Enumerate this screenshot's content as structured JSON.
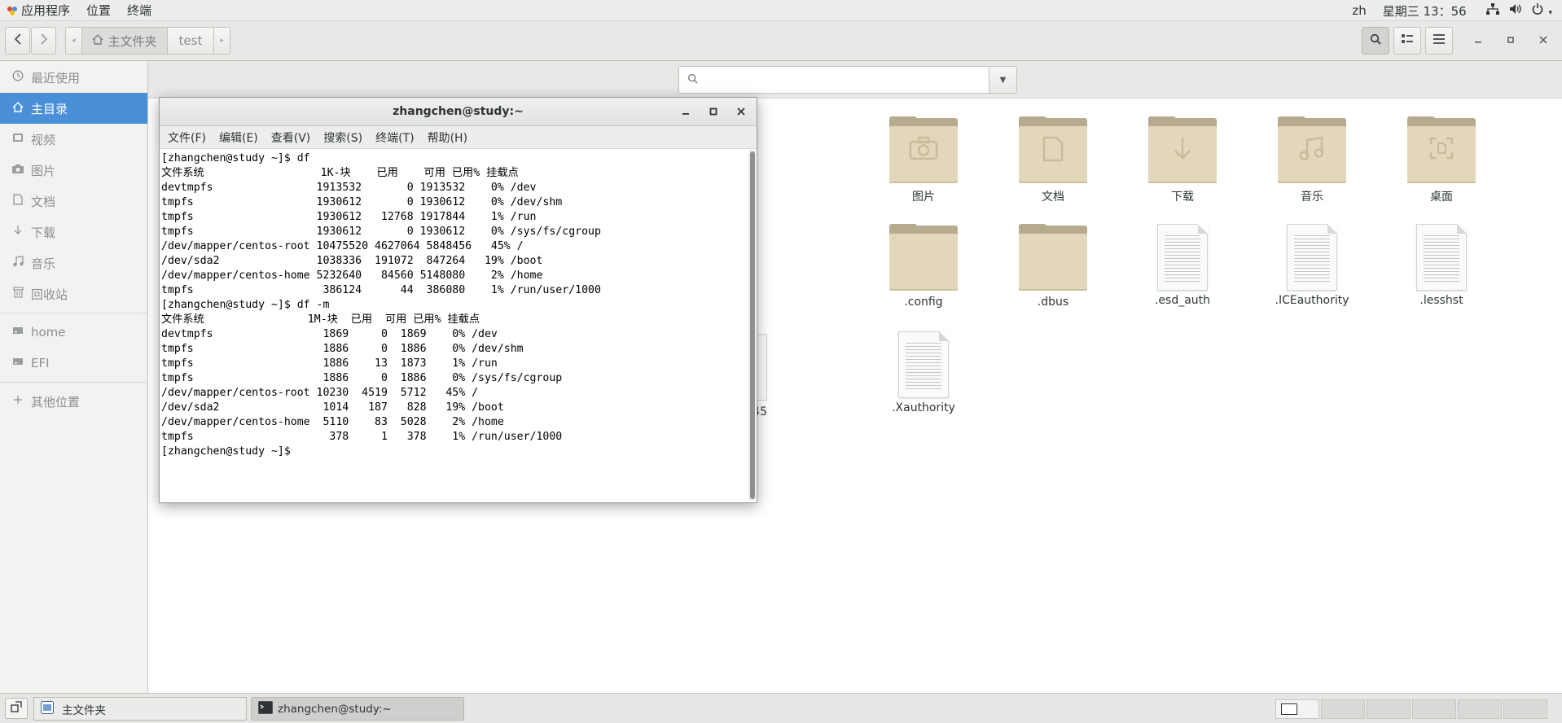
{
  "topbar": {
    "apps_label": "应用程序",
    "places_label": "位置",
    "terminal_label": "终端",
    "lang": "zh",
    "clock": "星期三 13：56"
  },
  "header": {
    "path_home": "主文件夹",
    "path_test": "test"
  },
  "sidebar": {
    "items": [
      {
        "label": "最近使用",
        "icon": "clock-icon"
      },
      {
        "label": "主目录",
        "icon": "home-icon"
      },
      {
        "label": "视频",
        "icon": "video-icon"
      },
      {
        "label": "图片",
        "icon": "camera-icon"
      },
      {
        "label": "文档",
        "icon": "document-icon"
      },
      {
        "label": "下载",
        "icon": "download-icon"
      },
      {
        "label": "音乐",
        "icon": "music-icon"
      },
      {
        "label": "回收站",
        "icon": "trash-icon"
      },
      {
        "label": "home",
        "icon": "drive-icon"
      },
      {
        "label": "EFI",
        "icon": "drive-icon"
      },
      {
        "label": "其他位置",
        "icon": "plus-icon"
      }
    ]
  },
  "files": [
    {
      "label": "图片",
      "type": "folder",
      "icon": "camera-icon"
    },
    {
      "label": "文档",
      "type": "folder",
      "icon": "document-icon"
    },
    {
      "label": "下载",
      "type": "folder",
      "icon": "download-icon"
    },
    {
      "label": "音乐",
      "type": "folder",
      "icon": "music-icon"
    },
    {
      "label": "桌面",
      "type": "folder",
      "icon": "desktop-icon"
    },
    {
      "label": ".config",
      "type": "folder"
    },
    {
      "label": ".dbus",
      "type": "folder"
    },
    {
      "label": ".esd_auth",
      "type": "file"
    },
    {
      "label": ".ICEauthority",
      "type": "file"
    },
    {
      "label": ".lesshst",
      "type": "file"
    },
    {
      "label": "3345",
      "type": "file"
    },
    {
      "label": ".Xauthority",
      "type": "file"
    }
  ],
  "terminal": {
    "title": "zhangchen@study:~",
    "menu": [
      "文件(F)",
      "编辑(E)",
      "查看(V)",
      "搜索(S)",
      "终端(T)",
      "帮助(H)"
    ],
    "output": "[zhangchen@study ~]$ df\n文件系统                  1K-块    已用    可用 已用% 挂载点\ndevtmpfs                1913532       0 1913532    0% /dev\ntmpfs                   1930612       0 1930612    0% /dev/shm\ntmpfs                   1930612   12768 1917844    1% /run\ntmpfs                   1930612       0 1930612    0% /sys/fs/cgroup\n/dev/mapper/centos-root 10475520 4627064 5848456   45% /\n/dev/sda2               1038336  191072  847264   19% /boot\n/dev/mapper/centos-home 5232640   84560 5148080    2% /home\ntmpfs                    386124      44  386080    1% /run/user/1000\n[zhangchen@study ~]$ df -m\n文件系统                1M-块  已用  可用 已用% 挂载点\ndevtmpfs                 1869     0  1869    0% /dev\ntmpfs                    1886     0  1886    0% /dev/shm\ntmpfs                    1886    13  1873    1% /run\ntmpfs                    1886     0  1886    0% /sys/fs/cgroup\n/dev/mapper/centos-root 10230  4519  5712   45% /\n/dev/sda2                1014   187   828   19% /boot\n/dev/mapper/centos-home  5110    83  5028    2% /home\ntmpfs                     378     1   378    1% /run/user/1000\n[zhangchen@study ~]$ "
  },
  "taskbar": {
    "task1": "主文件夹",
    "task2": "zhangchen@study:~"
  },
  "colors": {
    "accent": "#4a90d9",
    "folder": "#e3d7bb"
  }
}
